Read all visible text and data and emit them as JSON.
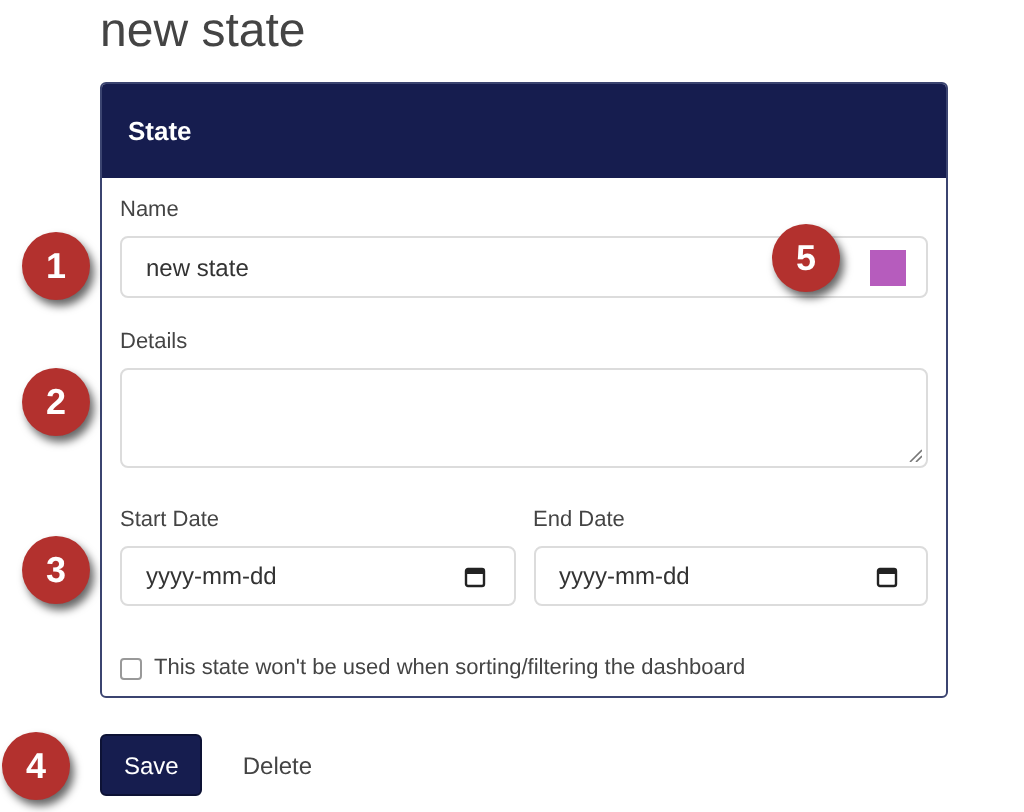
{
  "page_title": "new state",
  "card": {
    "title": "State",
    "name_field": {
      "label": "Name",
      "value": "new state",
      "color": "#b65cbd",
      "callout": "1",
      "color_callout": "5"
    },
    "details_field": {
      "label": "Details",
      "callout": "2"
    },
    "dates": {
      "callout": "3",
      "fields": [
        {
          "label": "Start Date",
          "placeholder": "yyyy-mm-dd"
        },
        {
          "label": "End Date",
          "placeholder": "yyyy-mm-dd"
        }
      ]
    },
    "exclude_checkbox": {
      "label": "This state won't be used when sorting/filtering the dashboard",
      "checked": false
    }
  },
  "actions": {
    "callout": "4",
    "buttons": [
      {
        "label": "Save",
        "kind": "primary"
      },
      {
        "label": "Delete",
        "kind": "link"
      }
    ]
  }
}
